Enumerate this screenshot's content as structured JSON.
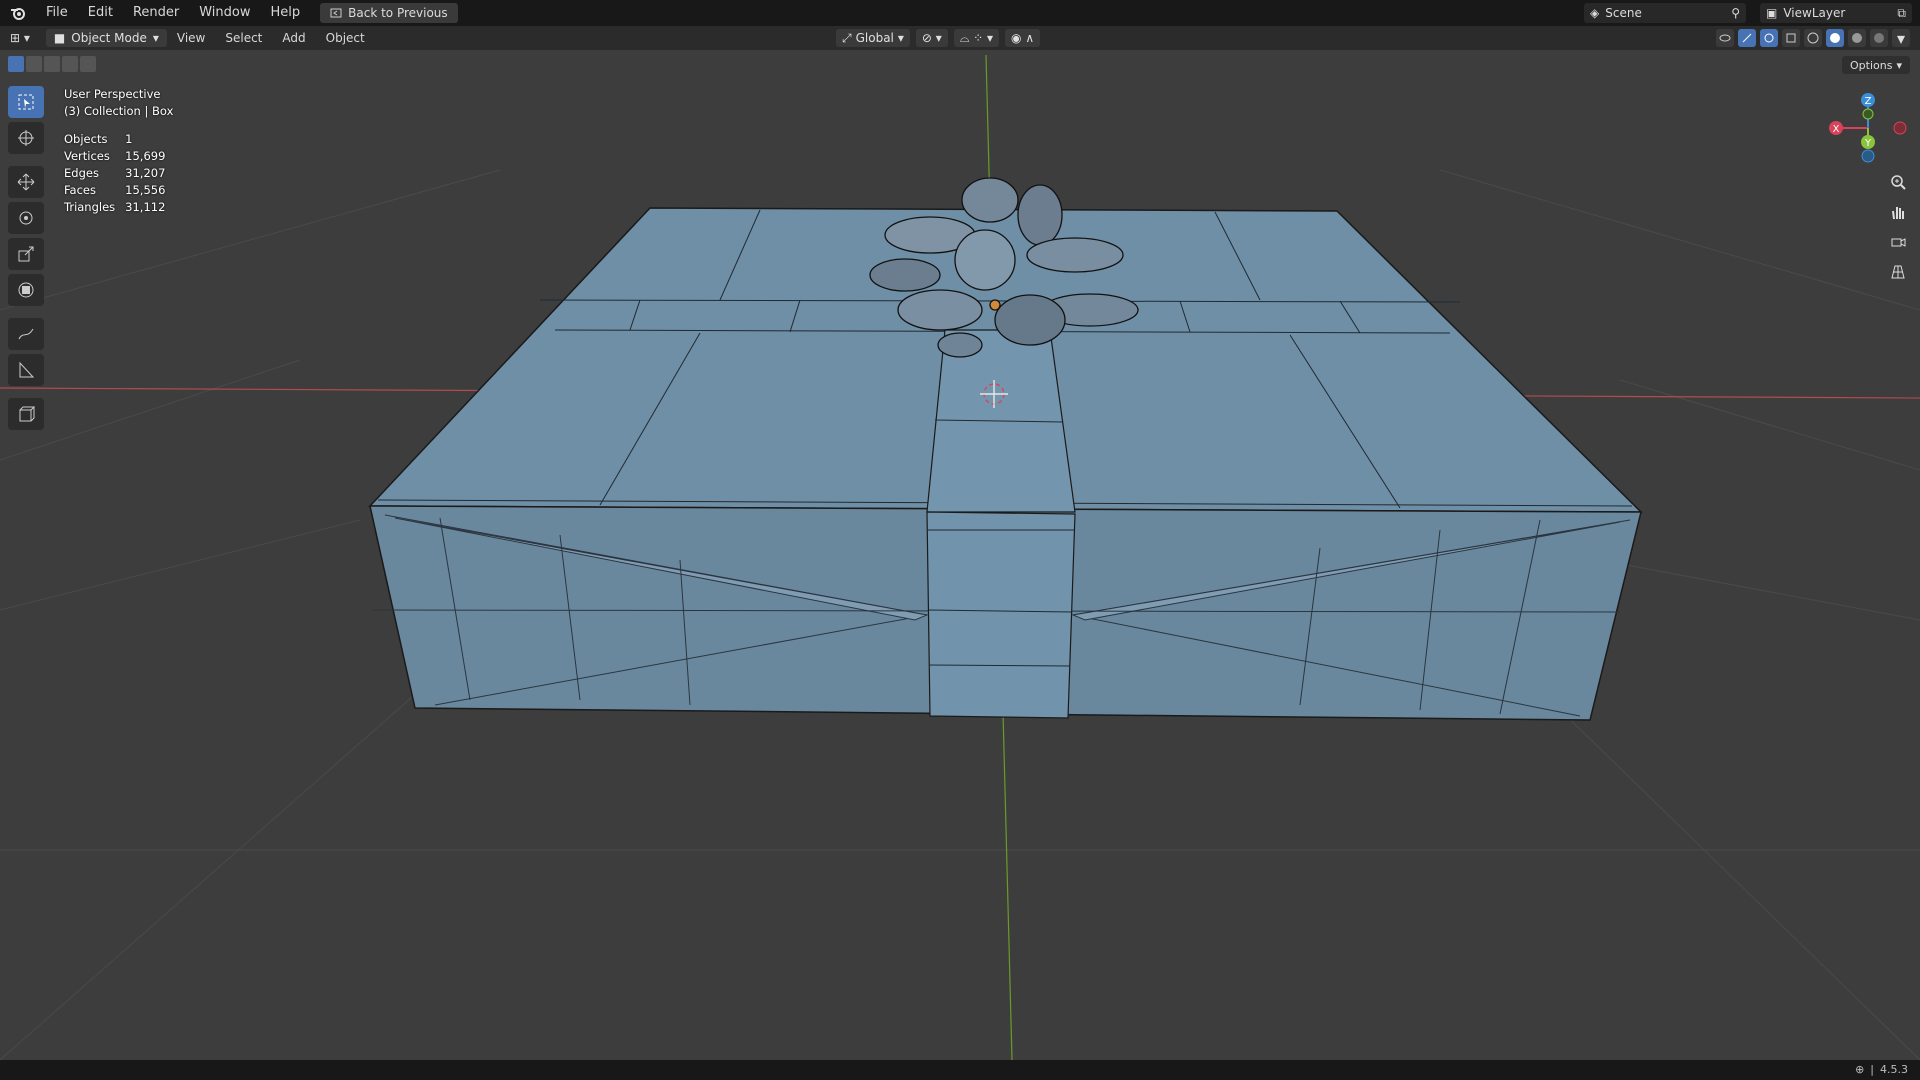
{
  "menu": {
    "items": [
      "File",
      "Edit",
      "Render",
      "Window",
      "Help"
    ],
    "back_button": "Back to Previous"
  },
  "scene": {
    "name": "Scene",
    "view_layer": "ViewLayer"
  },
  "header": {
    "mode": "Object Mode",
    "items": [
      "View",
      "Select",
      "Add",
      "Object"
    ],
    "transform_orientation": "Global",
    "options_label": "Options"
  },
  "viewport": {
    "view_name": "User Perspective",
    "collection": "(3) Collection | Box",
    "stats": [
      {
        "label": "Objects",
        "value": "1"
      },
      {
        "label": "Vertices",
        "value": "15,699"
      },
      {
        "label": "Edges",
        "value": "31,207"
      },
      {
        "label": "Faces",
        "value": "15,556"
      },
      {
        "label": "Triangles",
        "value": "31,112"
      }
    ]
  },
  "gizmo": {
    "x": "X",
    "y": "Y",
    "z": "Z"
  },
  "status": {
    "version": "4.5.3"
  },
  "colors": {
    "accent": "#4772b3",
    "x_axis": "#d9435a",
    "y_axis": "#8ac43c",
    "z_axis": "#3b8fd9",
    "box": "#6f8fa6"
  }
}
